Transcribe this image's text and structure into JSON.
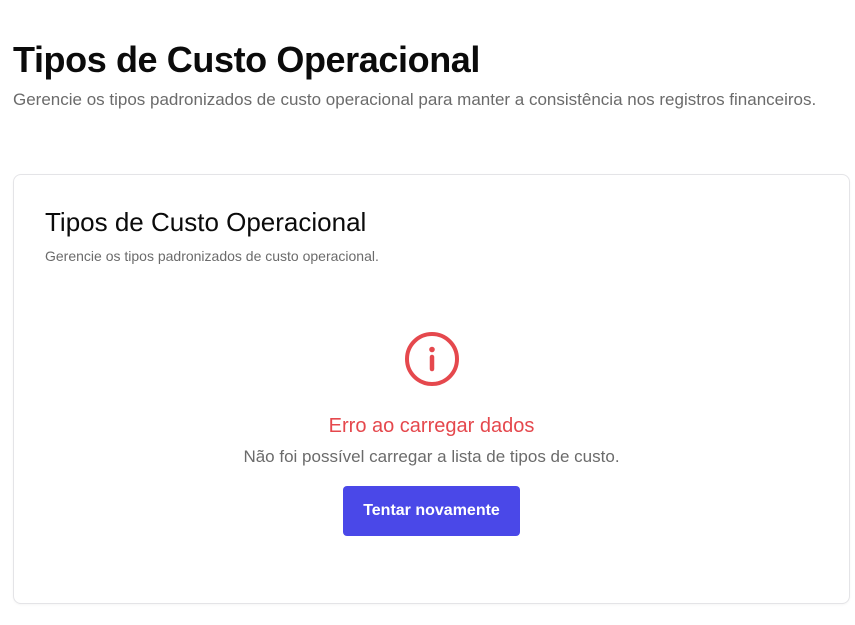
{
  "header": {
    "title": "Tipos de Custo Operacional",
    "subtitle": "Gerencie os tipos padronizados de custo operacional para manter a consistência nos registros financeiros."
  },
  "card": {
    "title": "Tipos de Custo Operacional",
    "subtitle": "Gerencie os tipos padronizados de custo operacional.",
    "error": {
      "icon": "info-circle-icon",
      "icon_color": "#e5484d",
      "title": "Erro ao carregar dados",
      "message": "Não foi possível carregar a lista de tipos de custo.",
      "retry_label": "Tentar novamente"
    }
  },
  "colors": {
    "error": "#e5484d",
    "primary": "#4a48e8"
  }
}
